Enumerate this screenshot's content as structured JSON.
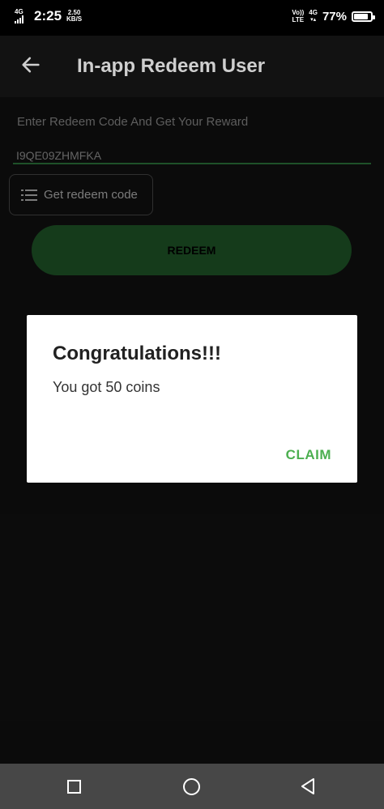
{
  "status_bar": {
    "network_left": "4G",
    "time": "2:25",
    "speed_value": "2.50",
    "speed_unit": "KB/S",
    "volte_top": "Vo))",
    "volte_bottom": "LTE",
    "network_right": "4G",
    "battery_percent": "77%"
  },
  "app_bar": {
    "title": "In-app Redeem User"
  },
  "form": {
    "prompt": "Enter Redeem Code And Get Your Reward",
    "code_value": "I9QE09ZHMFKA",
    "get_code_label": "Get redeem code",
    "redeem_label": "REDEEM"
  },
  "dialog": {
    "title": "Congratulations!!!",
    "message": "You got 50 coins",
    "claim_label": "CLAIM"
  },
  "colors": {
    "accent_green": "#4caf50",
    "button_green": "#215b2a",
    "background": "#121212"
  }
}
